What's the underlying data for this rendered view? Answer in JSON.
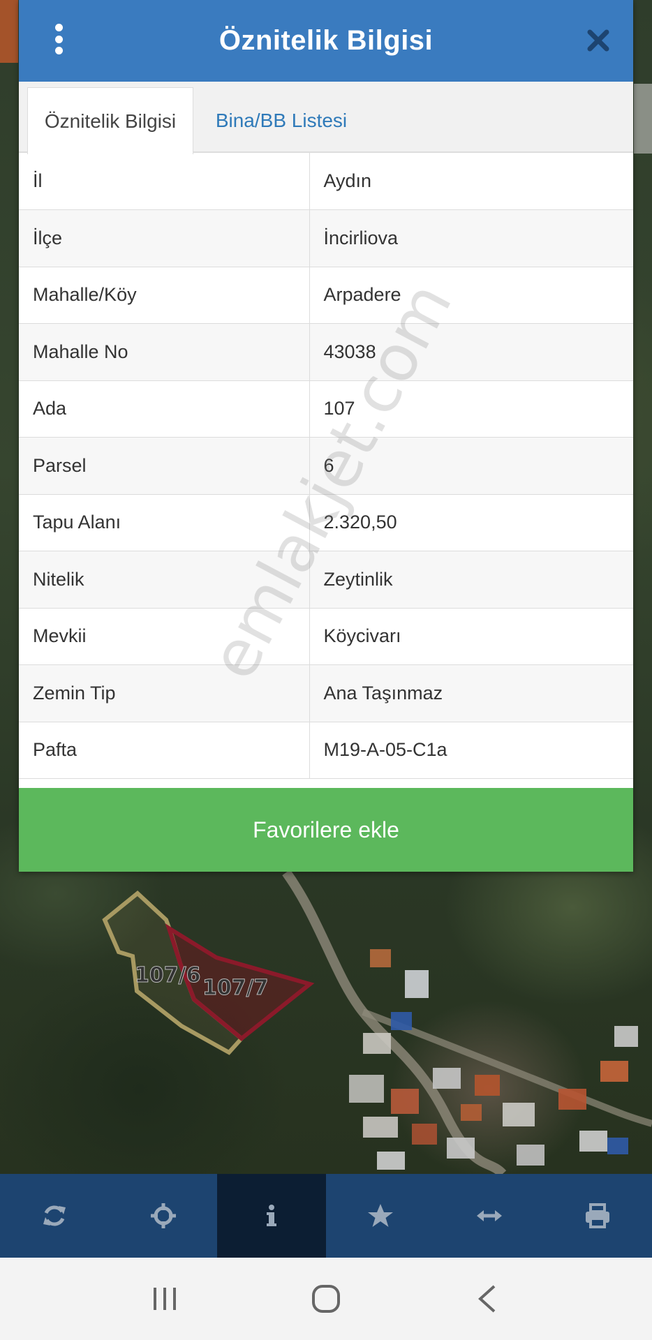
{
  "dialog": {
    "title": "Öznitelik Bilgisi",
    "tabs": [
      {
        "label": "Öznitelik Bilgisi",
        "active": true
      },
      {
        "label": "Bina/BB Listesi",
        "active": false
      }
    ],
    "rows": [
      {
        "key": "İl",
        "value": "Aydın"
      },
      {
        "key": "İlçe",
        "value": "İncirliova"
      },
      {
        "key": "Mahalle/Köy",
        "value": "Arpadere"
      },
      {
        "key": "Mahalle No",
        "value": "43038"
      },
      {
        "key": "Ada",
        "value": "107"
      },
      {
        "key": "Parsel",
        "value": "6"
      },
      {
        "key": "Tapu Alanı",
        "value": "2.320,50"
      },
      {
        "key": "Nitelik",
        "value": "Zeytinlik"
      },
      {
        "key": "Mevkii",
        "value": "Köycivarı"
      },
      {
        "key": "Zemin Tip",
        "value": "Ana Taşınmaz"
      },
      {
        "key": "Pafta",
        "value": "M19-A-05-C1a"
      }
    ],
    "favorite_label": "Favorilere ekle"
  },
  "map": {
    "parcel_labels": [
      "107/6",
      "107/7"
    ],
    "parcel_colors": {
      "outline_6": "#a89a62",
      "outline_7": "#8b1a2a"
    }
  },
  "watermark": "emlakjet.com",
  "toolbar": {
    "icons": [
      "refresh-icon",
      "crosshair-icon",
      "info-icon",
      "star-icon",
      "measure-arrows-icon",
      "print-icon"
    ],
    "active_index": 2,
    "colors": {
      "bar": "#1d4470",
      "active": "#0c1e33",
      "icon": "#9aa9ba"
    }
  },
  "system_nav": [
    "recent-apps-icon",
    "home-icon",
    "back-icon"
  ]
}
